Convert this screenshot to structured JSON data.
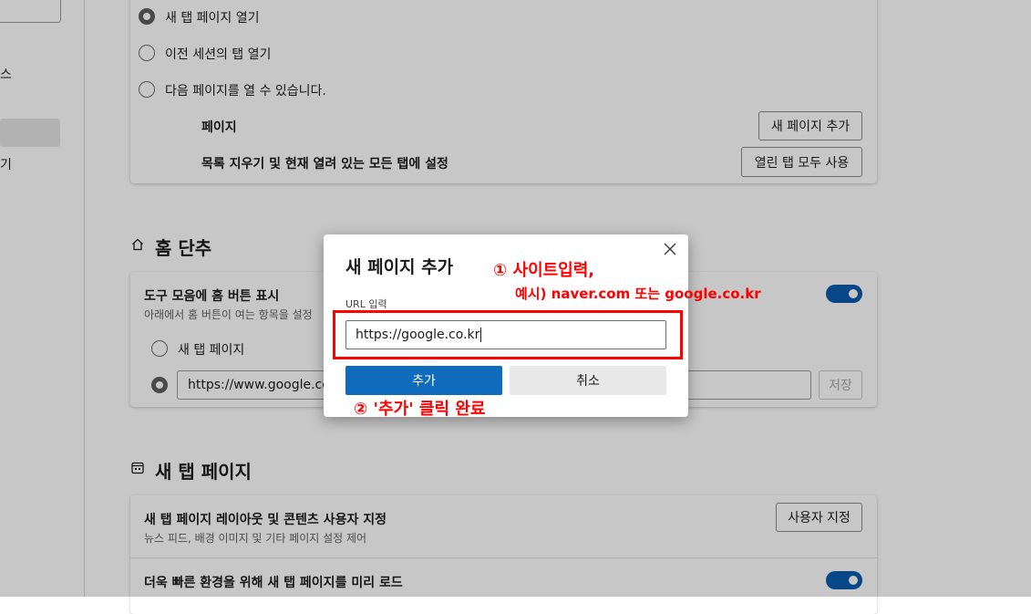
{
  "sidebar": {
    "partial_item_1": "스",
    "partial_item_2": "기"
  },
  "startup": {
    "options": [
      {
        "label": "새 탭 페이지 열기",
        "checked": true
      },
      {
        "label": "이전 세션의 탭 열기",
        "checked": false
      },
      {
        "label": "다음 페이지를 열 수 있습니다.",
        "checked": false
      }
    ],
    "pages_label": "페이지",
    "add_page_button": "새 페이지 추가",
    "clear_label": "목록 지우기 및 현재 열려 있는 모든 탭에 설정",
    "use_all_tabs_button": "열린 탭 모두 사용"
  },
  "home": {
    "section_title": "홈 단추",
    "show_home_label": "도구 모음에 홈 버튼 표시",
    "show_home_sub": "아래에서 홈 버튼이 여는 항목을 설정",
    "show_home_on": true,
    "option_newtab": "새 탭 페이지",
    "url_value": "https://www.google.co.kr",
    "save_button": "저장"
  },
  "newtab": {
    "section_title": "새 탭 페이지",
    "layout_label": "새 탭 페이지 레이아웃 및 콘텐츠 사용자 지정",
    "layout_sub": "뉴스 피드, 배경 이미지 및 기타 페이지 설정 제어",
    "customize_button": "사용자 지정",
    "preload_label": "더욱 빠른 환경을 위해 새 탭 페이지를 미리 로드",
    "preload_on": true
  },
  "dialog": {
    "title": "새 페이지 추가",
    "url_label": "URL 입력",
    "url_value": "https://google.co.kr",
    "add_button": "추가",
    "cancel_button": "취소"
  },
  "annotations": {
    "step1_line1": "① 사이트입력,",
    "step1_line2": "예시) naver.com 또는 google.co.kr",
    "step2": "② '추가' 클릭 완료"
  },
  "colors": {
    "accent": "#0f6cbd",
    "toggle_on": "#0b5cad",
    "annotation": "#ff0000"
  },
  "icons": {
    "home_section": "home-icon",
    "newtab_section": "newtab-icon",
    "close": "close-icon"
  }
}
